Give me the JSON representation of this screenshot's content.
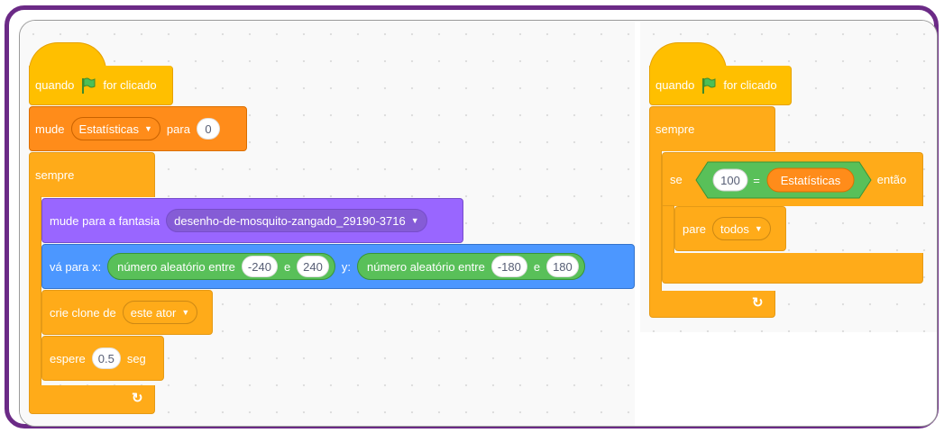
{
  "left_script": {
    "hat": {
      "before": "quando",
      "after": "for clicado",
      "icon": "green-flag-icon"
    },
    "set_var": {
      "label": "mude",
      "variable": "Estatísticas",
      "label2": "para",
      "value": "0"
    },
    "forever": {
      "label": "sempre"
    },
    "costume": {
      "label": "mude para a fantasia",
      "costume": "desenho-de-mosquito-zangado_29190-3716"
    },
    "goto": {
      "label": "vá para x:",
      "rand_x": {
        "label": "número aleatório entre",
        "from": "-240",
        "and": "e",
        "to": "240"
      },
      "y_label": "y:",
      "rand_y": {
        "label": "número aleatório entre",
        "from": "-180",
        "and": "e",
        "to": "180"
      }
    },
    "clone": {
      "label": "crie clone de",
      "target": "este ator"
    },
    "wait": {
      "label": "espere",
      "value": "0.5",
      "unit": "seg"
    },
    "loop_icon": "↻"
  },
  "right_script": {
    "hat": {
      "before": "quando",
      "after": "for clicado",
      "icon": "green-flag-icon"
    },
    "forever": {
      "label": "sempre"
    },
    "if": {
      "label": "se",
      "left": "100",
      "op": "=",
      "right": "Estatísticas",
      "then": "então"
    },
    "stop": {
      "label": "pare",
      "option": "todos"
    },
    "loop_icon": "↻"
  },
  "colors": {
    "events": "#ffbf00",
    "control": "#ffab19",
    "variables": "#ff8c1a",
    "looks": "#9966ff",
    "motion": "#4c97ff",
    "operators": "#59c059",
    "frame": "#6b2a86"
  }
}
